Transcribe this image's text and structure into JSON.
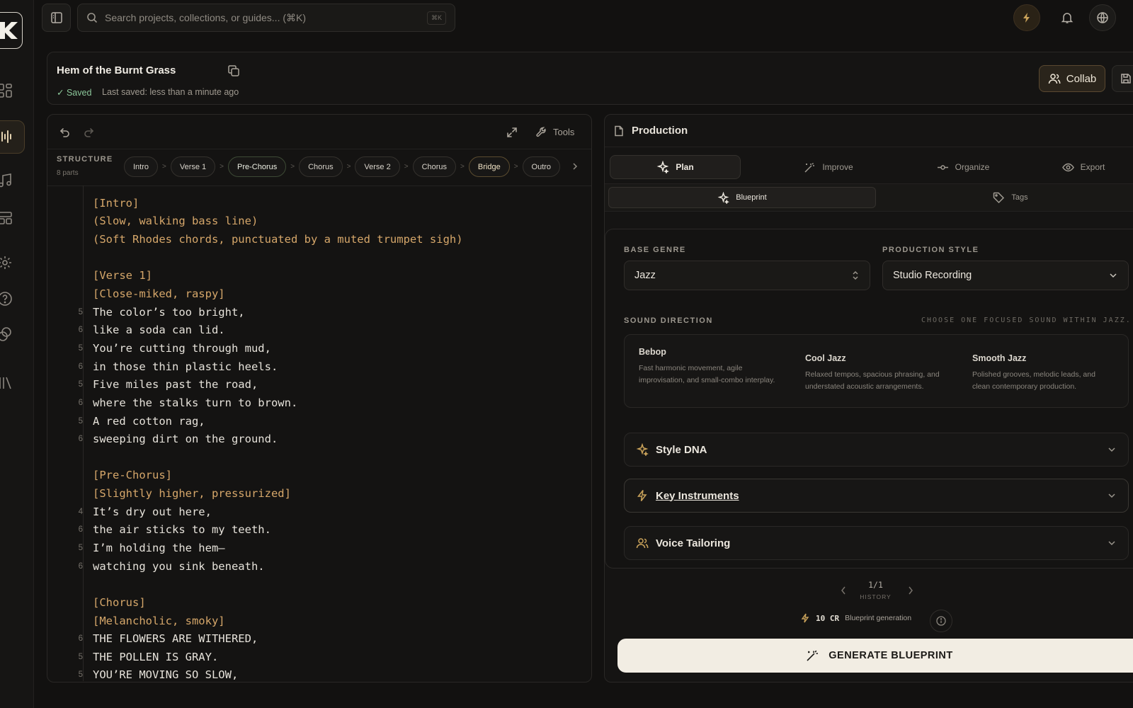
{
  "topbar": {
    "search_placeholder": "Search projects, collections, or guides... (⌘K)",
    "search_shortcut": "⌘K"
  },
  "header": {
    "title": "Hem of the Burnt Grass",
    "saved_label": "✓ Saved",
    "last_saved": "Last saved: less than a minute ago",
    "collab_label": "Collab"
  },
  "editor": {
    "tools_label": "Tools",
    "structure_label": "STRUCTURE",
    "structure_count": "8 parts",
    "sections": [
      "Intro",
      "Verse 1",
      "Pre-Chorus",
      "Chorus",
      "Verse 2",
      "Chorus",
      "Bridge",
      "Outro"
    ],
    "lyrics": [
      {
        "n": "",
        "text": "[Intro]",
        "tag": true
      },
      {
        "n": "",
        "text": "(Slow, walking bass line)",
        "tag": true
      },
      {
        "n": "",
        "text": "(Soft Rhodes chords, punctuated by a muted trumpet sigh)",
        "tag": true
      },
      {
        "n": "",
        "text": "",
        "tag": false
      },
      {
        "n": "",
        "text": "[Verse 1]",
        "tag": true
      },
      {
        "n": "",
        "text": "[Close-miked, raspy]",
        "tag": true
      },
      {
        "n": "5",
        "text": "The color’s too bright,",
        "tag": false
      },
      {
        "n": "6",
        "text": "like a soda can lid.",
        "tag": false
      },
      {
        "n": "5",
        "text": "You’re cutting through mud,",
        "tag": false
      },
      {
        "n": "6",
        "text": "in those thin plastic heels.",
        "tag": false
      },
      {
        "n": "5",
        "text": "Five miles past the road,",
        "tag": false
      },
      {
        "n": "6",
        "text": "where the stalks turn to brown.",
        "tag": false
      },
      {
        "n": "5",
        "text": "A red cotton rag,",
        "tag": false
      },
      {
        "n": "6",
        "text": "sweeping dirt on the ground.",
        "tag": false
      },
      {
        "n": "",
        "text": "",
        "tag": false
      },
      {
        "n": "",
        "text": "[Pre-Chorus]",
        "tag": true
      },
      {
        "n": "",
        "text": "[Slightly higher, pressurized]",
        "tag": true
      },
      {
        "n": "4",
        "text": "It’s dry out here,",
        "tag": false
      },
      {
        "n": "6",
        "text": "the air sticks to my teeth.",
        "tag": false
      },
      {
        "n": "5",
        "text": "I’m holding the hem—",
        "tag": false
      },
      {
        "n": "6",
        "text": "watching you sink beneath.",
        "tag": false
      },
      {
        "n": "",
        "text": "",
        "tag": false
      },
      {
        "n": "",
        "text": "[Chorus]",
        "tag": true
      },
      {
        "n": "",
        "text": "[Melancholic, smoky]",
        "tag": true
      },
      {
        "n": "6",
        "text": "THE FLOWERS ARE WITHERED,",
        "tag": false
      },
      {
        "n": "5",
        "text": "THE POLLEN IS GRAY.",
        "tag": false
      },
      {
        "n": "5",
        "text": "YOU’RE MOVING SO SLOW,",
        "tag": false
      }
    ]
  },
  "production": {
    "title": "Production",
    "tabs": [
      "Plan",
      "Improve",
      "Organize",
      "Export"
    ],
    "subtabs": [
      "Blueprint",
      "Tags"
    ],
    "base_genre_label": "BASE GENRE",
    "base_genre_value": "Jazz",
    "production_style_label": "PRODUCTION STYLE",
    "production_style_value": "Studio Recording",
    "sound_direction_label": "SOUND DIRECTION",
    "sound_direction_hint": "CHOOSE ONE FOCUSED SOUND WITHIN JAZZ.",
    "sound_options": [
      {
        "name": "Bebop",
        "desc": "Fast harmonic movement, agile improvisation, and small-combo interplay."
      },
      {
        "name": "Cool Jazz",
        "desc": "Relaxed tempos, spacious phrasing, and understated acoustic arrangements."
      },
      {
        "name": "Smooth Jazz",
        "desc": "Polished grooves, melodic leads, and clean contemporary production."
      }
    ],
    "accordions": [
      "Style DNA",
      "Key Instruments",
      "Voice Tailoring"
    ],
    "history_count": "1/1",
    "history_label": "HISTORY",
    "credit_amount": "10 CR",
    "credit_label": "Blueprint generation",
    "generate_label": "GENERATE BLUEPRINT"
  }
}
